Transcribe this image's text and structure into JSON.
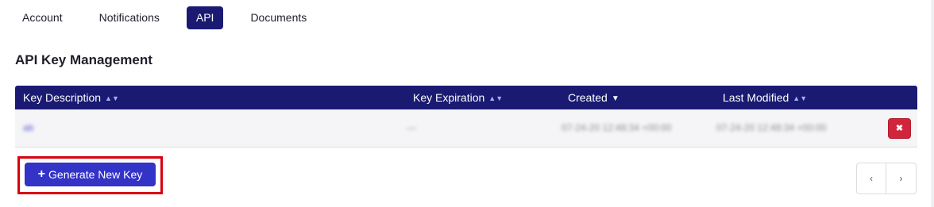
{
  "tabs": [
    {
      "label": "Account",
      "active": false
    },
    {
      "label": "Notifications",
      "active": false
    },
    {
      "label": "API",
      "active": true
    },
    {
      "label": "Documents",
      "active": false
    }
  ],
  "page_title": "API Key Management",
  "table": {
    "headers": [
      "Key Description",
      "Key Expiration",
      "Created",
      "Last Modified"
    ],
    "sort_indicators": {
      "unsorted": "▲▼",
      "active_desc": "▼"
    },
    "rows": [
      {
        "description": "ab",
        "expiration": "—",
        "created": "07-24-20 12:48:34 +00:00",
        "modified": "07-24-20 12:48:34 +00:00"
      }
    ],
    "delete_icon": "✖"
  },
  "generate_button": {
    "label": "Generate New Key",
    "icon": "plus-icon"
  },
  "pagination": {
    "prev": "‹",
    "next": "›"
  },
  "colors": {
    "header": "#1a1a73",
    "primary_button": "#3333c7",
    "danger": "#d0253b",
    "highlight": "#d9000d"
  }
}
